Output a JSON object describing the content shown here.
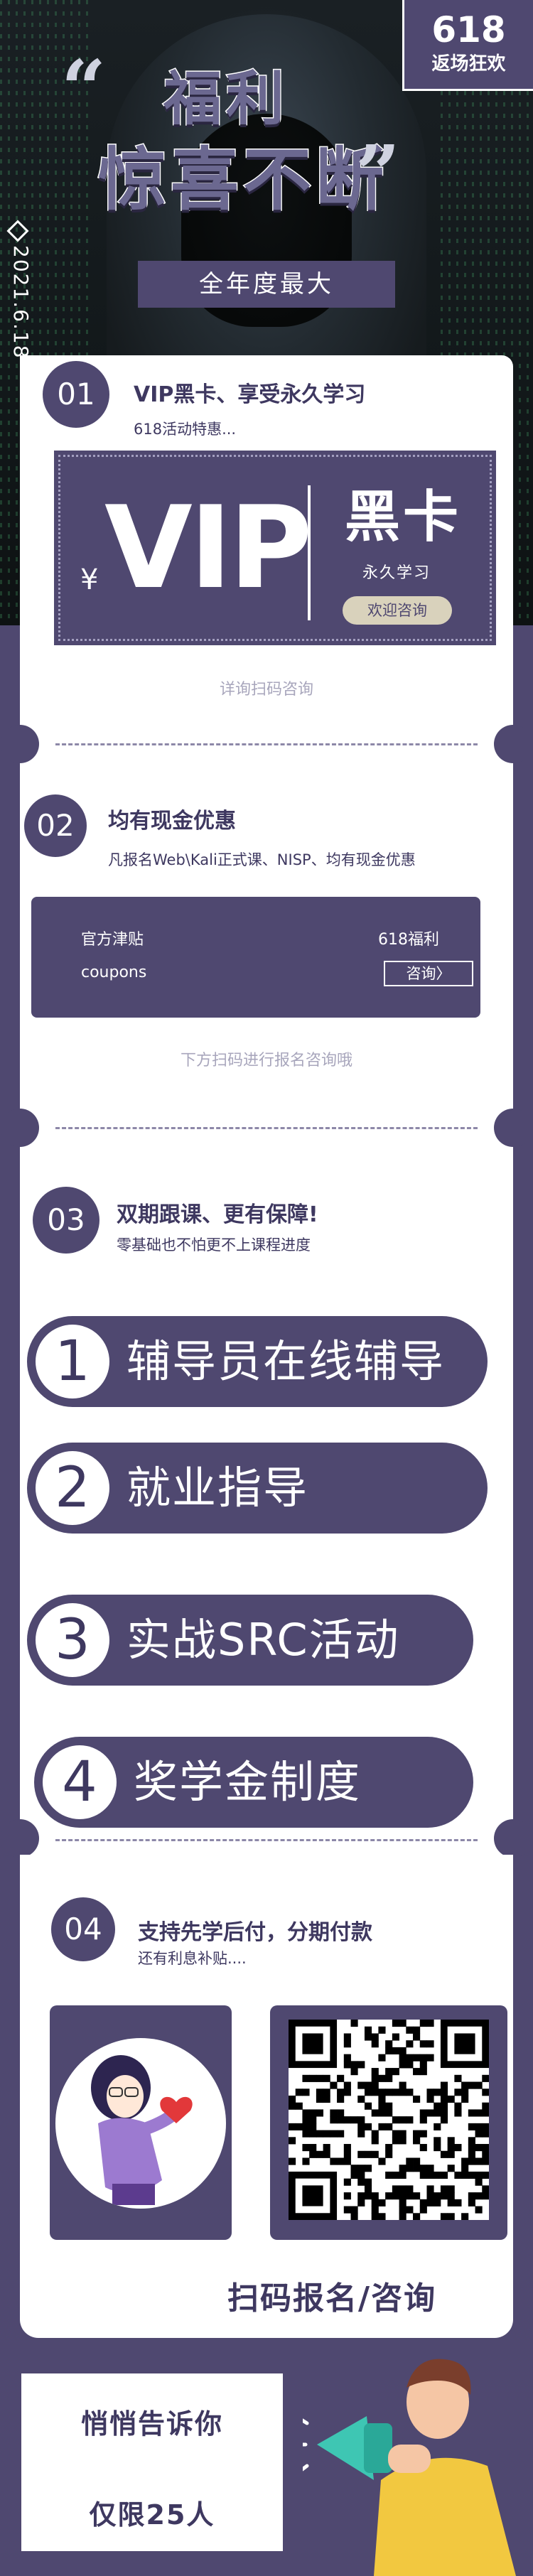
{
  "hero": {
    "badge_number": "618",
    "badge_text": "返场狂欢",
    "quote_open": "“",
    "quote_close": "”",
    "title_line1": "福利",
    "title_line2": "惊喜不断",
    "subtitle": "全年度最大",
    "date": "2021.6.18"
  },
  "section1": {
    "number": "01",
    "title": "VIP黑卡、享受永久学习",
    "subtitle": "618活动特惠...",
    "ticket": {
      "yen": "¥",
      "vip": "VIP",
      "black_card": "黑卡",
      "permanent": "永久学习",
      "button": "欢迎咨询"
    },
    "hint": "详询扫码咨询"
  },
  "section2": {
    "number": "02",
    "title": "均有现金优惠",
    "subtitle": "凡报名Web\\Kali正式课、NISP、均有现金优惠",
    "coupon": {
      "label_left_top": "官方津贴",
      "label_right_top": "618福利",
      "label_left_bottom": "coupons",
      "button": "咨询〉"
    },
    "hint": "下方扫码进行报名咨询哦"
  },
  "section3": {
    "number": "03",
    "title": "双期跟课、更有保障!",
    "subtitle": "零基础也不怕更不上课程进度",
    "items": [
      {
        "num": "1",
        "label": "辅导员在线辅导"
      },
      {
        "num": "2",
        "label": "就业指导"
      },
      {
        "num": "3",
        "label": "实战SRC活动"
      },
      {
        "num": "4",
        "label": "奖学金制度"
      }
    ]
  },
  "section4": {
    "number": "04",
    "title": "支持先学后付，分期付款",
    "subtitle": "还有利息补贴....",
    "scan_text": "扫码报名/咨询"
  },
  "bottom": {
    "line1": "悄悄告诉你",
    "line2": "仅限25人"
  },
  "colors": {
    "primary": "#4f4870",
    "text": "#3e3860",
    "hint": "#a8a6bc",
    "button_beige": "#d9d2bc"
  }
}
